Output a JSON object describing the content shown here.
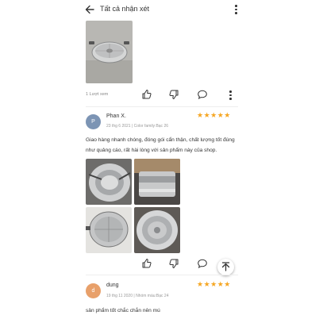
{
  "header": {
    "title": "Tất cả nhận xét"
  },
  "review_prev": {
    "helpful": "1 Lượt xem"
  },
  "review1": {
    "avatar_initial": "P",
    "avatar_color": "#7c94b4",
    "name": "Phan X.",
    "meta": "23 thg 6 2021 | Color family:Bạc 26",
    "stars": "★★★★★",
    "text": "Giao hàng nhanh chóng, đóng gói cẩn thận, chất lượng tốt đúng như quảng cáo, rất hài lòng với sản phẩm này của shop."
  },
  "review2": {
    "avatar_initial": "d",
    "avatar_color": "#e8a06a",
    "name": "dung",
    "meta": "19 thg 11 2020 | Nhóm màu:Bạc 24",
    "stars": "★★★★★",
    "text": "sản phẩm tốt chắc chắn nên mú"
  },
  "colors": {
    "star": "#f5a623",
    "icon": "#333333"
  },
  "icons": [
    "back-arrow-icon",
    "more-vert-icon",
    "thumb-up-icon",
    "thumb-down-icon",
    "comment-icon",
    "scroll-top-icon"
  ]
}
